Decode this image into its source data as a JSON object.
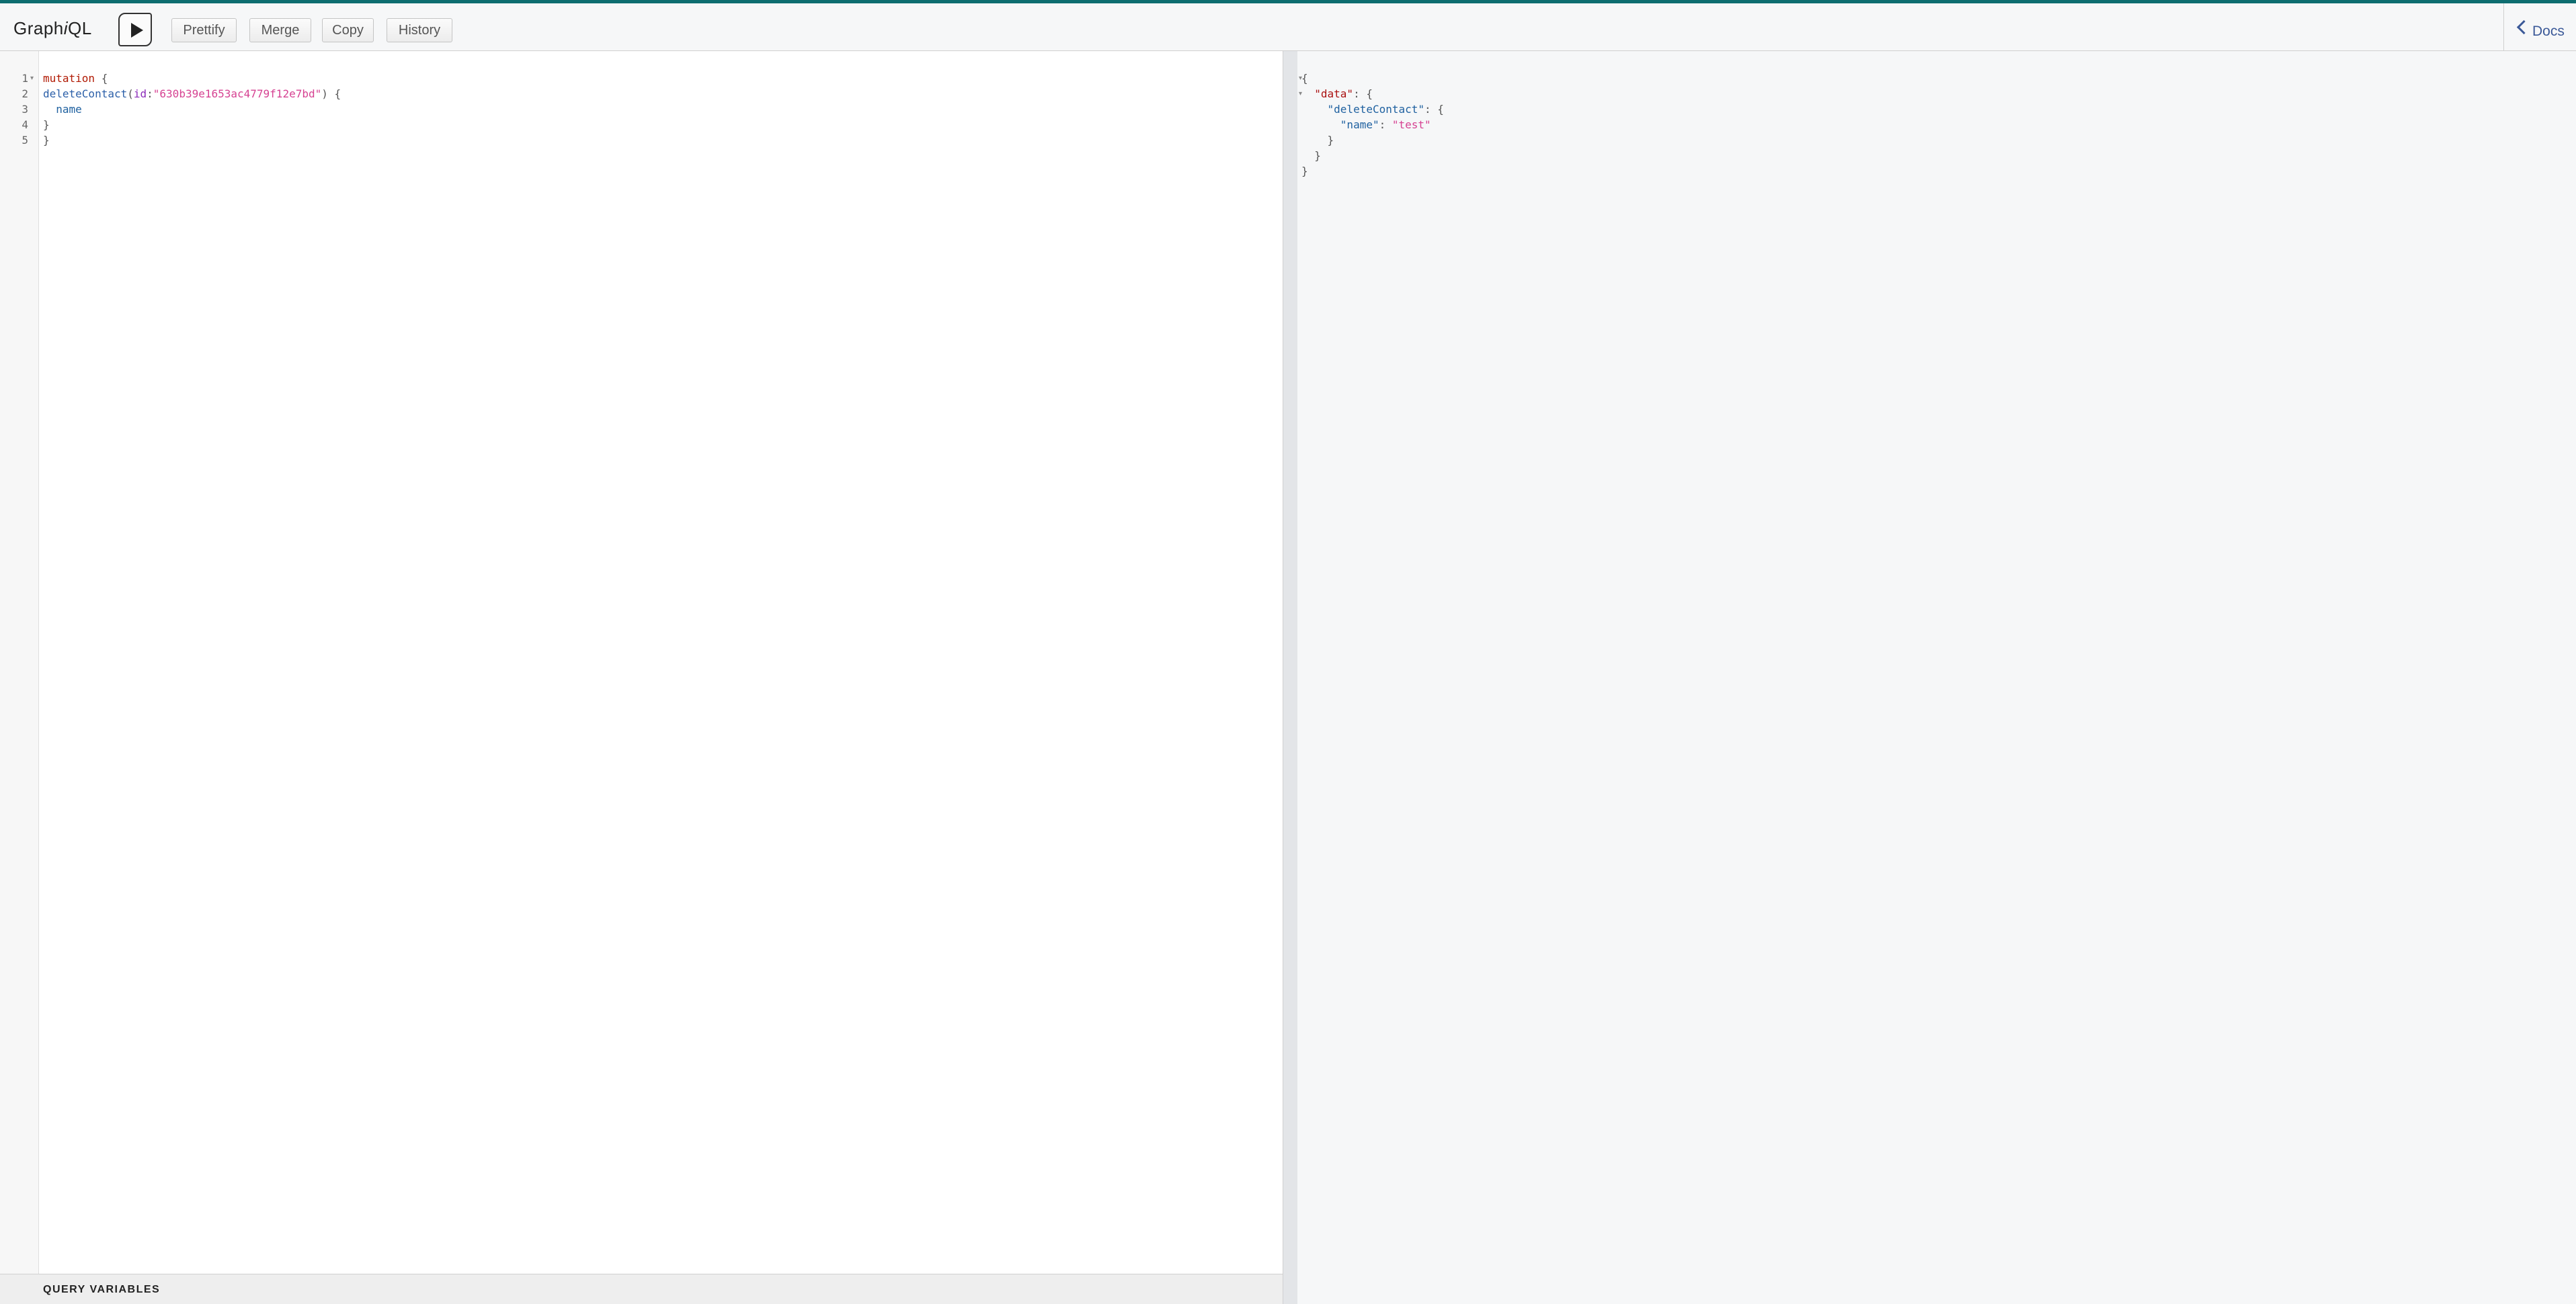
{
  "app": {
    "title_prefix": "Graph",
    "title_italic": "i",
    "title_suffix": "QL"
  },
  "toolbar": {
    "execute_icon": "play-icon",
    "buttons": [
      "Prettify",
      "Merge",
      "Copy",
      "History"
    ]
  },
  "docs": {
    "label": "Docs",
    "icon": "chevron-left-icon"
  },
  "editor": {
    "line_numbers": [
      "1",
      "2",
      "3",
      "4",
      "5"
    ],
    "lines": [
      {
        "keyword": "mutation",
        "rest": " {"
      },
      {
        "field": "deleteContact",
        "open": "(",
        "arg": "id",
        "colon": ":",
        "value": "\"630b39e1653ac4779f12e7bd\"",
        "close": ") {"
      },
      {
        "indent": "  ",
        "field": "name"
      },
      {
        "text": "}"
      },
      {
        "text": "}"
      }
    ]
  },
  "query_variables": {
    "label": "QUERY VARIABLES"
  },
  "result": {
    "lines": [
      {
        "text": "{"
      },
      {
        "indent": "  ",
        "key": "\"data\"",
        "rest": ": {"
      },
      {
        "indent": "    ",
        "key": "\"deleteContact\"",
        "rest": ": {"
      },
      {
        "indent": "      ",
        "key": "\"name\"",
        "sep": ": ",
        "value": "\"test\""
      },
      {
        "indent": "    ",
        "text": "}"
      },
      {
        "indent": "  ",
        "text": "}"
      },
      {
        "text": "}"
      }
    ]
  },
  "colors": {
    "accent": "#0e6d70",
    "keyword": "#b11a04",
    "string": "#d64292",
    "property": "#1f61a0",
    "link": "#3b5998"
  }
}
